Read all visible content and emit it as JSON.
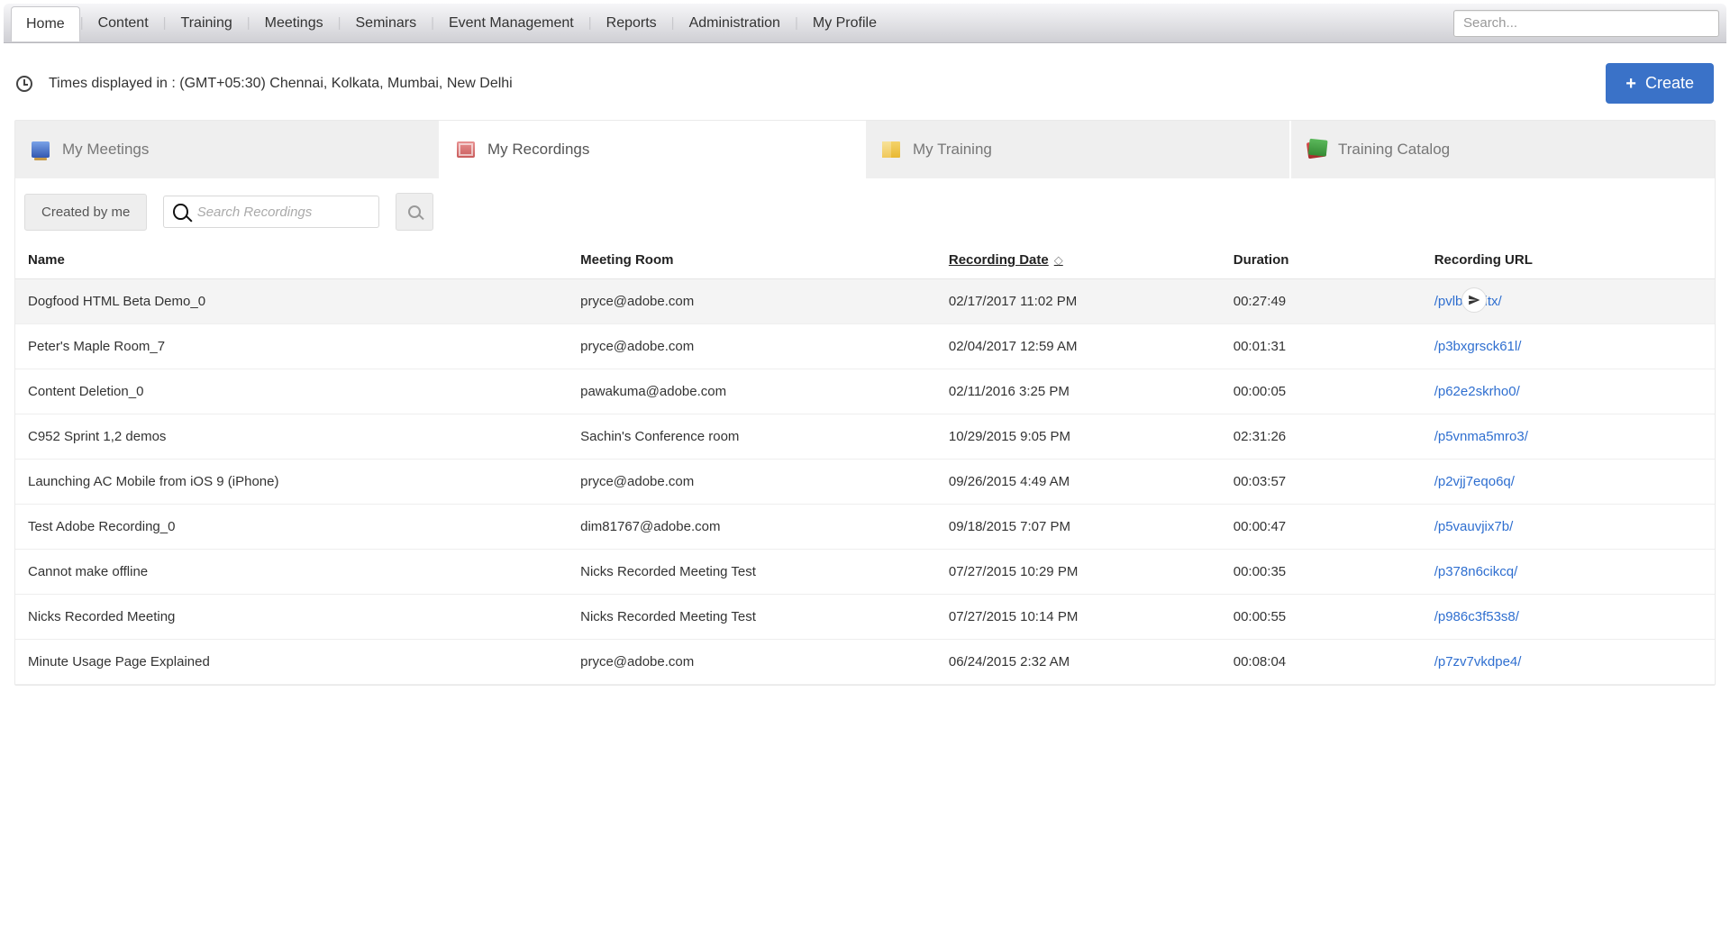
{
  "topnav": {
    "tabs": [
      "Home",
      "Content",
      "Training",
      "Meetings",
      "Seminars",
      "Event Management",
      "Reports",
      "Administration",
      "My Profile"
    ],
    "active_index": 0,
    "search_placeholder": "Search..."
  },
  "infobar": {
    "timezone_text": "Times displayed in : (GMT+05:30) Chennai, Kolkata, Mumbai, New Delhi",
    "create_label": "Create"
  },
  "section_tabs": {
    "items": [
      {
        "label": "My Meetings",
        "icon": "meet"
      },
      {
        "label": "My Recordings",
        "icon": "rec"
      },
      {
        "label": "My Training",
        "icon": "train"
      },
      {
        "label": "Training Catalog",
        "icon": "cat"
      }
    ],
    "active_index": 1
  },
  "filters": {
    "created_by_me_label": "Created by me",
    "search_placeholder": "Search Recordings"
  },
  "table": {
    "columns": {
      "name": "Name",
      "room": "Meeting Room",
      "date": "Recording Date",
      "duration": "Duration",
      "url": "Recording URL"
    },
    "sort_column": "date",
    "rows": [
      {
        "name": "Dogfood HTML Beta Demo_0",
        "room": "pryce@adobe.com",
        "date": "02/17/2017 11:02 PM",
        "duration": "00:27:49",
        "url": "/pvlbchoitx/",
        "has_action": true
      },
      {
        "name": "Peter's Maple Room_7",
        "room": "pryce@adobe.com",
        "date": "02/04/2017 12:59 AM",
        "duration": "00:01:31",
        "url": "/p3bxgrsck61l/"
      },
      {
        "name": "Content Deletion_0",
        "room": "pawakuma@adobe.com",
        "date": "02/11/2016 3:25 PM",
        "duration": "00:00:05",
        "url": "/p62e2skrho0/"
      },
      {
        "name": "C952 Sprint 1,2 demos",
        "room": "Sachin's Conference room",
        "date": "10/29/2015 9:05 PM",
        "duration": "02:31:26",
        "url": "/p5vnma5mro3/"
      },
      {
        "name": "Launching AC Mobile from iOS 9 (iPhone)",
        "room": "pryce@adobe.com",
        "date": "09/26/2015 4:49 AM",
        "duration": "00:03:57",
        "url": "/p2vjj7eqo6q/"
      },
      {
        "name": "Test Adobe Recording_0",
        "room": "dim81767@adobe.com",
        "date": "09/18/2015 7:07 PM",
        "duration": "00:00:47",
        "url": "/p5vauvjix7b/"
      },
      {
        "name": "Cannot make offline",
        "room": "Nicks Recorded Meeting Test",
        "date": "07/27/2015 10:29 PM",
        "duration": "00:00:35",
        "url": "/p378n6cikcq/"
      },
      {
        "name": "Nicks Recorded Meeting",
        "room": "Nicks Recorded Meeting Test",
        "date": "07/27/2015 10:14 PM",
        "duration": "00:00:55",
        "url": "/p986c3f53s8/"
      },
      {
        "name": "Minute Usage Page Explained",
        "room": "pryce@adobe.com",
        "date": "06/24/2015 2:32 AM",
        "duration": "00:08:04",
        "url": "/p7zv7vkdpe4/"
      }
    ]
  }
}
